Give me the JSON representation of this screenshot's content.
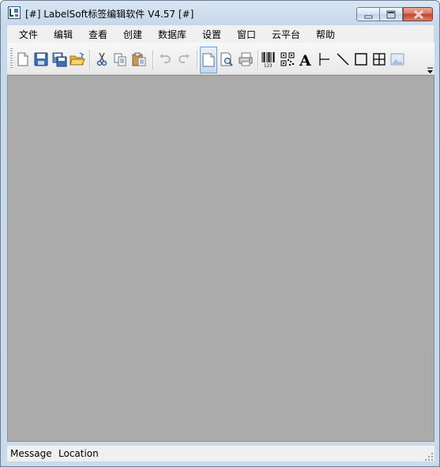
{
  "window": {
    "title": "[#] LabelSoft标签编辑软件 V4.57 [#]",
    "app_icon": "labelsoft-app-icon"
  },
  "window_controls": {
    "minimize_icon": "minimize-icon",
    "maximize_icon": "maximize-icon",
    "close_icon": "close-icon"
  },
  "menu": {
    "items": [
      "文件",
      "编辑",
      "查看",
      "创建",
      "数据库",
      "设置",
      "窗口",
      "云平台",
      "帮助"
    ]
  },
  "toolbar": {
    "buttons": [
      {
        "icon": "new-file-icon"
      },
      {
        "icon": "save-icon"
      },
      {
        "icon": "save-as-icon"
      },
      {
        "icon": "open-folder-icon"
      },
      {
        "icon": "cut-icon"
      },
      {
        "icon": "copy-icon"
      },
      {
        "icon": "paste-icon"
      },
      {
        "icon": "undo-icon",
        "disabled": true
      },
      {
        "icon": "redo-icon",
        "disabled": true
      },
      {
        "icon": "page-setup-icon",
        "active": true
      },
      {
        "icon": "print-preview-icon"
      },
      {
        "icon": "print-icon"
      },
      {
        "icon": "barcode-icon",
        "label": "123"
      },
      {
        "icon": "qr-code-icon"
      },
      {
        "icon": "text-icon",
        "label": "A"
      },
      {
        "icon": "vertical-line-icon"
      },
      {
        "icon": "diagonal-line-icon"
      },
      {
        "icon": "rectangle-icon"
      },
      {
        "icon": "table-icon"
      },
      {
        "icon": "image-icon"
      }
    ]
  },
  "status": {
    "message_label": "Message",
    "location_label": "Location"
  },
  "colors": {
    "workspace": "#ababab",
    "titlebar": "#c9daec",
    "close_button": "#c4432d",
    "active_tool": "#bfd9f3"
  }
}
